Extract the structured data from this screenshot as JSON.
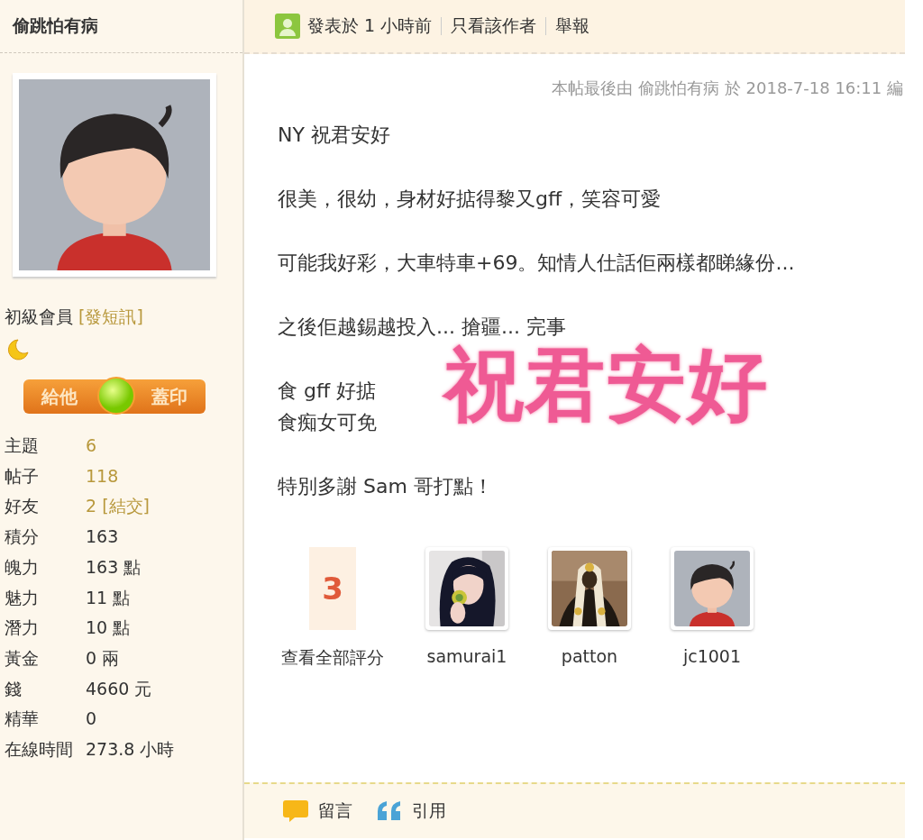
{
  "author": {
    "name": "偷跳怕有病",
    "rank": "初級會員",
    "message_link": "[發短訊]",
    "stamp_left": "給他",
    "stamp_right": "蓋印",
    "stats": [
      {
        "label": "主題",
        "value": "6",
        "kind": "link"
      },
      {
        "label": "帖子",
        "value": "118",
        "kind": "link"
      },
      {
        "label": "好友",
        "value": "2",
        "kind": "link",
        "action": "[結交]"
      },
      {
        "label": "積分",
        "value": "163",
        "kind": "text"
      },
      {
        "label": "魄力",
        "value": "163 點",
        "kind": "text"
      },
      {
        "label": "魅力",
        "value": "11 點",
        "kind": "text"
      },
      {
        "label": "潛力",
        "value": "10 點",
        "kind": "text"
      },
      {
        "label": "黃金",
        "value": "0 兩",
        "kind": "text"
      },
      {
        "label": "錢",
        "value": "4660 元",
        "kind": "text"
      },
      {
        "label": "精華",
        "value": "0",
        "kind": "text"
      },
      {
        "label": "在線時間",
        "value": "273.8 小時",
        "kind": "text"
      }
    ]
  },
  "post_header": {
    "posted": "發表於 1 小時前",
    "links": [
      "只看該作者",
      "舉報"
    ]
  },
  "edit_note": "本帖最後由 偷跳怕有病 於 2018-7-18 16:11 編",
  "paragraphs": [
    [
      "NY 祝君安好"
    ],
    [
      "很美，很幼，身材好掂得黎又gff，笑容可愛"
    ],
    [
      "可能我好彩，大車特車+69。知情人仕話佢兩樣都睇緣份..."
    ],
    [
      "之後佢越錫越投入... 搶疆... 完事"
    ],
    [
      "食 gff 好掂",
      "食痴女可免"
    ],
    [
      "特別多謝 Sam 哥打點！"
    ]
  ],
  "sticker": "祝君安好",
  "ratings": {
    "count": "3",
    "label": "查看全部評分",
    "raters": [
      {
        "name": "samurai1",
        "kind": "picture"
      },
      {
        "name": "patton",
        "kind": "picture"
      },
      {
        "name": "jc1001",
        "kind": "cartoon"
      }
    ]
  },
  "actions": [
    {
      "label": "留言",
      "kind": "comment"
    },
    {
      "label": "引用",
      "kind": "quote"
    }
  ]
}
